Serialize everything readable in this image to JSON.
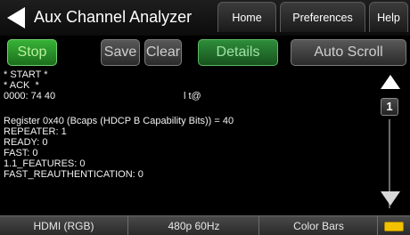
{
  "header": {
    "title": "Aux Channel Analyzer",
    "tabs": {
      "home": "Home",
      "preferences": "Preferences",
      "help": "Help"
    }
  },
  "toolbar": {
    "stop": "Stop",
    "save": "Save",
    "clear": "Clear",
    "details": "Details",
    "auto_scroll": "Auto Scroll"
  },
  "log": {
    "lines": [
      "* START *",
      "* ACK  *",
      "0000: 74 40",
      "",
      "Register 0x40 (Bcaps (HDCP B Capability Bits)) = 40",
      "REPEATER: 1",
      "READY: 0",
      "FAST: 0",
      "1.1_FEATURES: 0",
      "FAST_REAUTHENTICATION: 0"
    ],
    "ascii": "l t@"
  },
  "scroll": {
    "page": "1"
  },
  "status": {
    "interface": "HDMI (RGB)",
    "format": "480p 60Hz",
    "pattern": "Color Bars"
  },
  "icons": {
    "back": "back-arrow-icon",
    "scroll_up": "triangle-up-icon",
    "scroll_down": "triangle-down-icon",
    "battery": "battery-icon"
  },
  "colors": {
    "active_green": "#37b237",
    "details_green": "#2e8d3a",
    "battery": "#f2c200"
  }
}
